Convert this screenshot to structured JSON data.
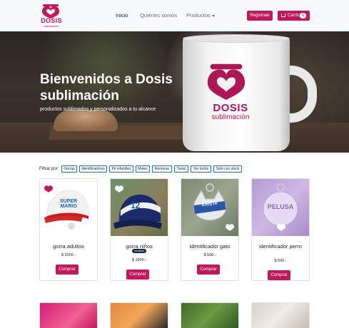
{
  "brand": {
    "name": "DOSIS",
    "tagline": "sublimación",
    "color": "#c2185b"
  },
  "nav": {
    "links": [
      "Inicio",
      "Quiénes somos",
      "Productos"
    ],
    "register_label": "Registrate",
    "cart_label": "Carrito",
    "cart_count": "0"
  },
  "hero": {
    "title": "Bienvenidos a Dosis sublimación",
    "subtitle": "productos sublimados y personalizados a tu alcance",
    "mug_word": "DOSIS",
    "mug_sub": "sublimación"
  },
  "filters": {
    "label": "Filtrar por:",
    "chips": [
      "Gorras",
      "Identificadores",
      "Kit infantiles",
      "Mates",
      "Remeras",
      "Tazas",
      "Ver todos",
      "Solo con stock"
    ]
  },
  "products": [
    {
      "title": "gorra adultos",
      "price": "$ 2000.-",
      "button": "Comprar",
      "badge": ""
    },
    {
      "title": "gorra niños",
      "price": "$ 1800.-",
      "button": "Comprar",
      "badge": "sin stock"
    },
    {
      "title": "identificador gato",
      "price": "$ 500.-",
      "button": "Comprar",
      "badge": ""
    },
    {
      "title": "identificador perro",
      "price": "$ 500.-",
      "button": "Comprar",
      "badge": ""
    }
  ],
  "product_images": {
    "card1_text": "SUPER MARIO",
    "card2_number": "12",
    "card3_name": "KRISTA",
    "card4_name": "PELUSA"
  },
  "colors": {
    "primary": "#c2185b",
    "chip_border": "#0d6efd",
    "badge_dark": "#1b2a4a"
  }
}
